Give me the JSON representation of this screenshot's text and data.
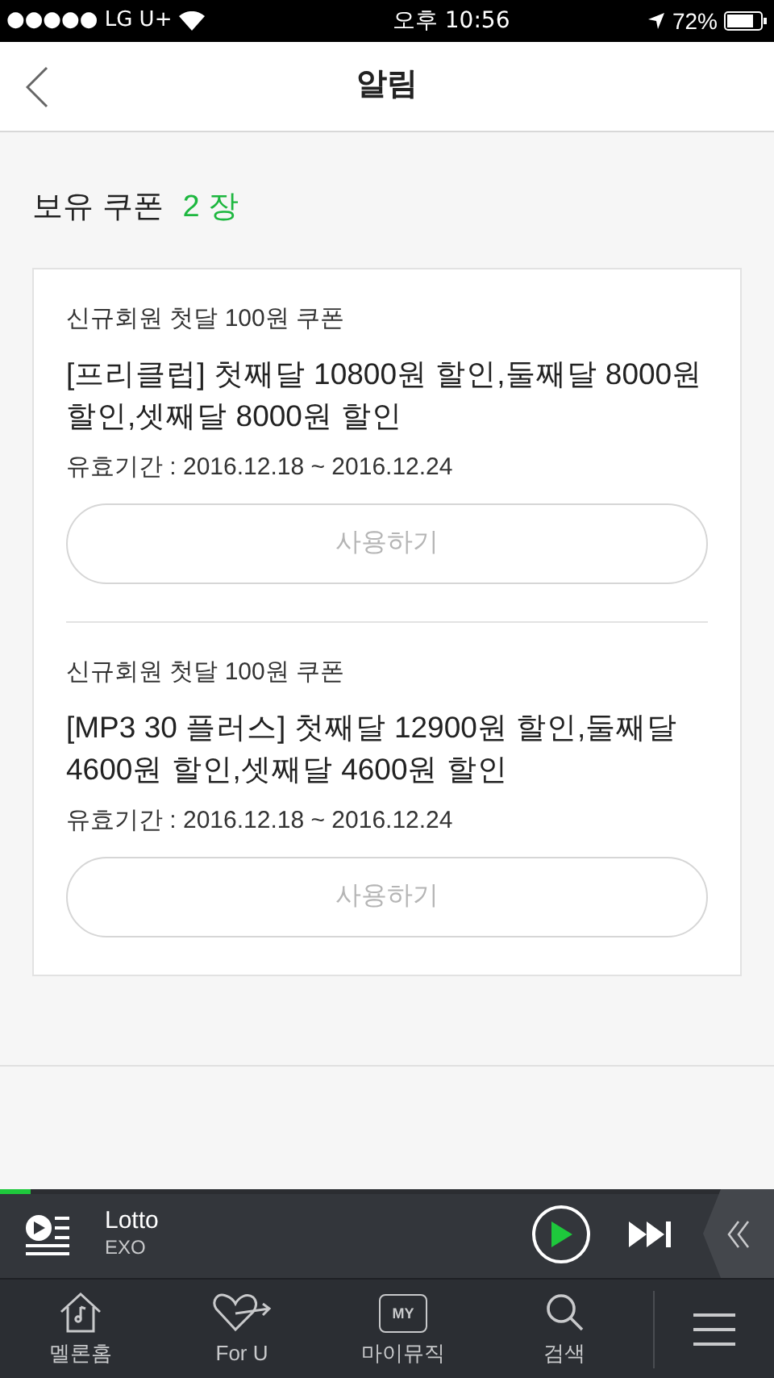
{
  "status_bar": {
    "carrier": "●●●●● LG U+",
    "time": "오후 10:56",
    "battery": "72%"
  },
  "header": {
    "title": "알림"
  },
  "coupon_summary": {
    "label": "보유 쿠폰",
    "count": "2 장"
  },
  "coupons": [
    {
      "name": "신규회원 첫달 100원 쿠폰",
      "description": "[프리클럽] 첫째달 10800원 할인,둘째달 8000원 할인,셋째달 8000원 할인",
      "validity": "유효기간 : 2016.12.18 ~ 2016.12.24",
      "button": {
        "label": "사용하기",
        "disabled": true
      }
    },
    {
      "name": "신규회원 첫달 100원 쿠폰",
      "description": "[MP3 30 플러스] 첫째달 12900원 할인,둘째달 4600원 할인,셋째달 4600원 할인",
      "validity": "유효기간 : 2016.12.18 ~ 2016.12.24",
      "button": {
        "label": "사용하기",
        "disabled": true
      }
    }
  ],
  "player": {
    "title": "Lotto",
    "artist": "EXO",
    "level": 0.04
  },
  "tab_bar": [
    {
      "label": "멜론홈",
      "kind": "home"
    },
    {
      "label": "For U",
      "kind": "heart"
    },
    {
      "label": "마이뮤직",
      "kind": "folder",
      "badge": "MY"
    },
    {
      "label": "검색",
      "kind": "search"
    }
  ]
}
